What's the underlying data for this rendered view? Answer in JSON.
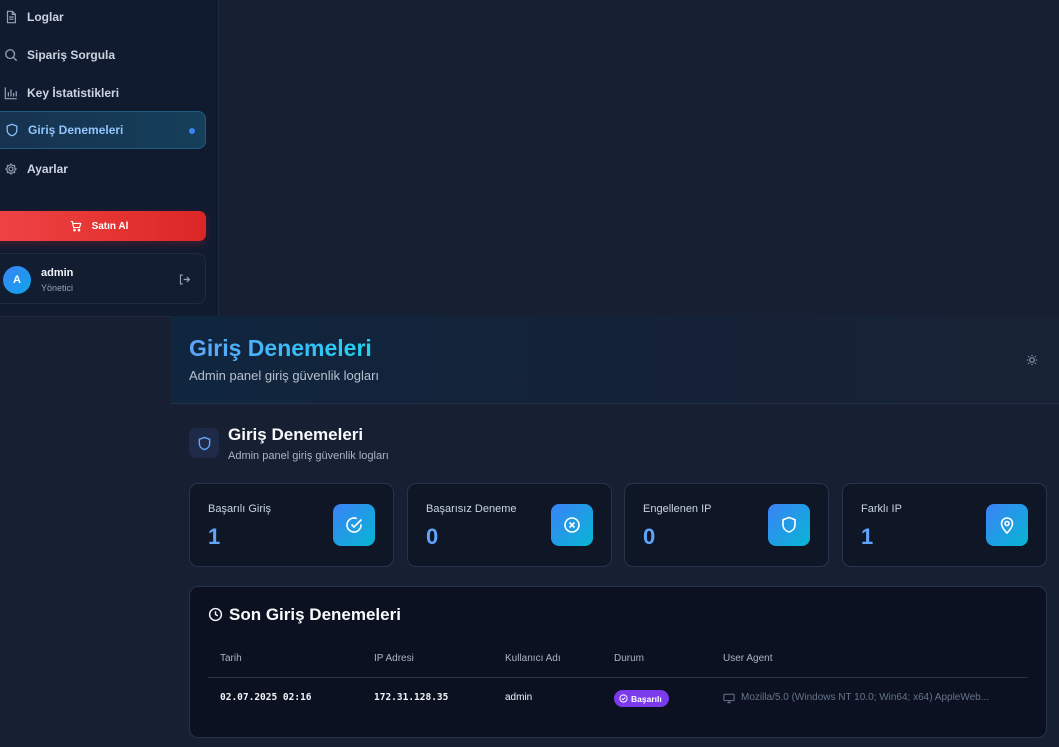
{
  "sidebar": {
    "items": [
      {
        "label": "Loglar",
        "icon": "document-icon"
      },
      {
        "label": "Sipariş Sorgula",
        "icon": "search-icon"
      },
      {
        "label": "Key İstatistikleri",
        "icon": "bar-chart-icon"
      },
      {
        "label": "Giriş Denemeleri",
        "icon": "shield-icon",
        "active": true
      },
      {
        "label": "Ayarlar",
        "icon": "gear-icon"
      }
    ],
    "buy_label": "Satın Al",
    "user": {
      "initial": "A",
      "name": "admin",
      "role": "Yönetici"
    }
  },
  "header": {
    "title": "Giriş Denemeleri",
    "subtitle": "Admin panel giriş güvenlik logları"
  },
  "section": {
    "title": "Giriş Denemeleri",
    "subtitle": "Admin panel giriş güvenlik logları"
  },
  "stats": [
    {
      "label": "Başarılı Giriş",
      "value": "1",
      "icon": "check-circle-icon"
    },
    {
      "label": "Başarısız Deneme",
      "value": "0",
      "icon": "x-circle-icon"
    },
    {
      "label": "Engellenen IP",
      "value": "0",
      "icon": "shield-icon"
    },
    {
      "label": "Farklı IP",
      "value": "1",
      "icon": "map-pin-icon"
    }
  ],
  "table": {
    "title": "Son Giriş Denemeleri",
    "columns": [
      "Tarih",
      "IP Adresi",
      "Kullanıcı Adı",
      "Durum",
      "User Agent"
    ],
    "rows": [
      {
        "date": "02.07.2025 02:16",
        "ip": "172.31.128.35",
        "username": "admin",
        "status": "Başarılı",
        "user_agent": "Mozilla/5.0 (Windows NT 10.0; Win64; x64) AppleWeb..."
      }
    ]
  },
  "colors": {
    "accent": "#60a5fa",
    "danger": "#ef4444",
    "success_badge": "#7c3aed",
    "background": "#172033"
  }
}
